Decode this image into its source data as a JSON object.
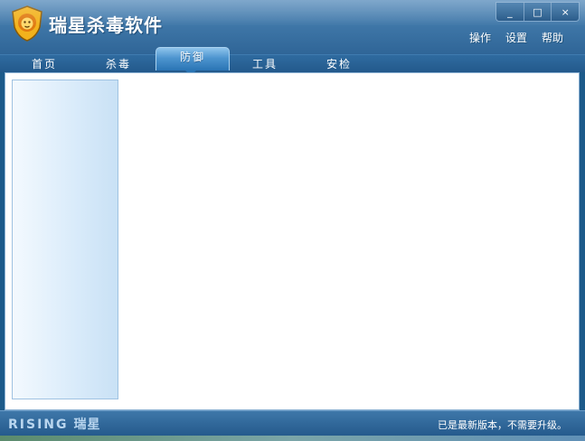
{
  "app": {
    "title": "瑞星杀毒软件"
  },
  "window_controls": {
    "minimize": "_",
    "maximize": "□",
    "close": "×"
  },
  "header_menu": [
    "操作",
    "设置",
    "帮助"
  ],
  "tabs": [
    {
      "label": "首页",
      "active": false
    },
    {
      "label": "杀毒",
      "active": false
    },
    {
      "label": "防御",
      "active": true
    },
    {
      "label": "工具",
      "active": false
    },
    {
      "label": "安检",
      "active": false
    }
  ],
  "footer": {
    "brand_en": "RISING",
    "brand_cn": "瑞星",
    "status": "已是最新版本，不需要升级。"
  },
  "colors": {
    "header": "#3f77a8",
    "tab_active": "#4d95cf",
    "content_bg": "#ffffff",
    "side_panel": "#d9ebfa"
  }
}
